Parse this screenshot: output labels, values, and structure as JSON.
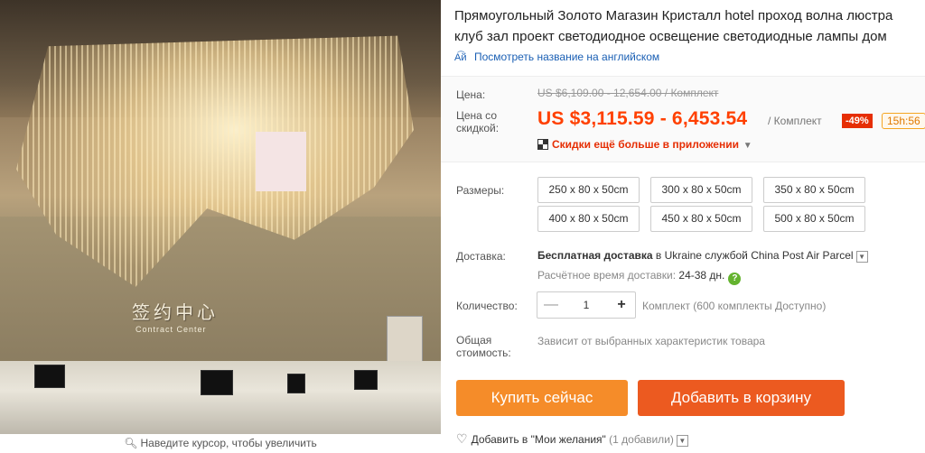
{
  "gallery": {
    "zoom_hint": "Наведите курсор, чтобы увеличить",
    "zoom_icon": "magnifier-icon"
  },
  "product": {
    "title_line1": "Прямоугольный Золото Магазин Кристалл hotel проход волна люстра",
    "title_line2": "клуб зал проект светодиодное освещение светодиодные лампы дом",
    "translate_link": "Посмотреть название на английском",
    "translate_icon": "translate-icon"
  },
  "price": {
    "price_label": "Цена:",
    "old_price": "US $6,109.00 - 12,654.00 / Комплект",
    "discount_label_line1": "Цена со",
    "discount_label_line2": "скидкой:",
    "new_price": "US $3,115.59 - 6,453.54",
    "unit": "/ Комплект",
    "discount_badge": "-49%",
    "timer": "15h:56",
    "app_deal": "Скидки ещё больше в приложении",
    "accent_color": "#ff4000"
  },
  "sizes": {
    "label": "Размеры:",
    "options": [
      "250 x 80 x 50cm",
      "300 x 80 x 50cm",
      "350 x 80 x 50cm",
      "400 x 80 x 50cm",
      "450 x 80 x 50cm",
      "500 x 80 x 50cm"
    ]
  },
  "shipping": {
    "label": "Доставка:",
    "main_bold": "Бесплатная доставка",
    "main_rest": " в Ukraine службой China Post Air Parcel",
    "time_label": "Расчётное время доставки:",
    "time_value": "24-38 дн."
  },
  "quantity": {
    "label": "Количество:",
    "value": "1",
    "note": "Комплект (600 комплекты Доступно)"
  },
  "total": {
    "label_line1": "Общая",
    "label_line2": "стоимость:",
    "note": "Зависит от выбранных характеристик товара"
  },
  "actions": {
    "buy_now": "Купить сейчас",
    "add_to_cart": "Добавить в корзину",
    "buy_color": "#f58c29",
    "cart_color": "#ec5a20"
  },
  "wishlist": {
    "label": "Добавить в \"Мои желания\"",
    "count": "(1 добавили)"
  }
}
